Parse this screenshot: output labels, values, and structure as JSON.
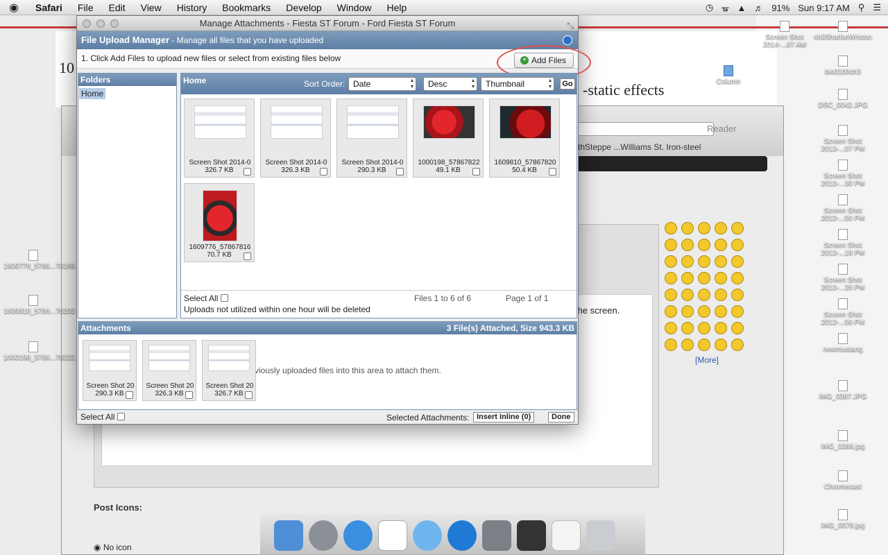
{
  "menubar": {
    "app": "Safari",
    "items": [
      "File",
      "Edit",
      "View",
      "History",
      "Bookmarks",
      "Develop",
      "Window",
      "Help"
    ],
    "battery": "91%",
    "clock": "Sun 9:17 AM"
  },
  "background": {
    "doc_big_text": "10",
    "doc_effects_text": "-static effects",
    "reader_label": "Reader",
    "bookmarks_text": "rthSteppe ...Williams St.   Iron-steel",
    "screen_text": "the screen.",
    "more_link": "[More]",
    "post_icons_title": "Post Icons:",
    "no_icon_label": "No icon"
  },
  "desktop_icons": [
    {
      "label": "Screen Shot 2014-...07 AM"
    },
    {
      "label": "ch3SharlseWriston"
    },
    {
      "label": "bio0100ch3"
    },
    {
      "label": "Column"
    },
    {
      "label": "DSC_0042.JPG"
    },
    {
      "label": "Screen Shot 2013-...07 PM"
    },
    {
      "label": "Screen Shot 2013-...30 PM"
    },
    {
      "label": "Screen Shot 2013-...50 PM"
    },
    {
      "label": "Screen Shot 2013-...18 PM"
    },
    {
      "label": "Screen Shot 2013-...26 PM"
    },
    {
      "label": "Screen Shot 2013-...56 PM"
    },
    {
      "label": "newmustang"
    },
    {
      "label": "IMG_0387.JPG"
    },
    {
      "label": "IMG_0386.jpg"
    },
    {
      "label": "Chromecast"
    },
    {
      "label": "IMG_0578.jpg"
    },
    {
      "label": "1609776_5786...78168..._n.jpg"
    },
    {
      "label": "1609810_5786...78202..._n.jpg"
    },
    {
      "label": "1000198_5786...78222..._n.jpg"
    }
  ],
  "dialog": {
    "window_title": "Manage Attachments - Fiesta ST Forum - Ford Fiesta ST Forum",
    "header_title": "File Upload Manager",
    "header_subtitle": " - Manage all files that you have uploaded",
    "instruction": "1. Click Add Files to upload new files or select from existing files below",
    "add_files_label": "Add Files",
    "folders_header": "Folders",
    "folder_home": "Home",
    "files_header": "Home",
    "sort_order_label": "Sort Order:",
    "sort_field": "Date",
    "sort_dir": "Desc",
    "view_mode": "Thumbnail",
    "go_label": "Go",
    "files": [
      {
        "name": "Screen Shot 2014-0",
        "size": "326.7 KB",
        "kind": "shot"
      },
      {
        "name": "Screen Shot 2014-0",
        "size": "326.3 KB",
        "kind": "shot"
      },
      {
        "name": "Screen Shot 2014-0",
        "size": "290.3 KB",
        "kind": "shot"
      },
      {
        "name": "1000198_57867822",
        "size": "49.1 KB",
        "kind": "car"
      },
      {
        "name": "1609810_57867820",
        "size": "50.4 KB",
        "kind": "car2"
      },
      {
        "name": "1609776_57867816",
        "size": "70.7 KB",
        "kind": "car3"
      }
    ],
    "select_all": "Select All",
    "files_count": "Files 1 to 6 of 6",
    "page_info": "Page 1 of 1",
    "delete_warning": "Uploads not utilized within one hour will be deleted",
    "attachments_header": "Attachments",
    "attachments_summary": "3 File(s) Attached, Size 943.3 KB",
    "attachments_drop_hint": "viously uploaded files into this area to attach them.",
    "attachments": [
      {
        "name": "Screen Shot 20",
        "size": "290.3 KB"
      },
      {
        "name": "Screen Shot 20",
        "size": "326.3 KB"
      },
      {
        "name": "Screen Shot 20",
        "size": "326.7 KB"
      }
    ],
    "attach_select_all": "Select All",
    "selected_attachments_label": "Selected Attachments:",
    "insert_inline_label": "Insert Inline (0)",
    "done_label": "Done"
  }
}
